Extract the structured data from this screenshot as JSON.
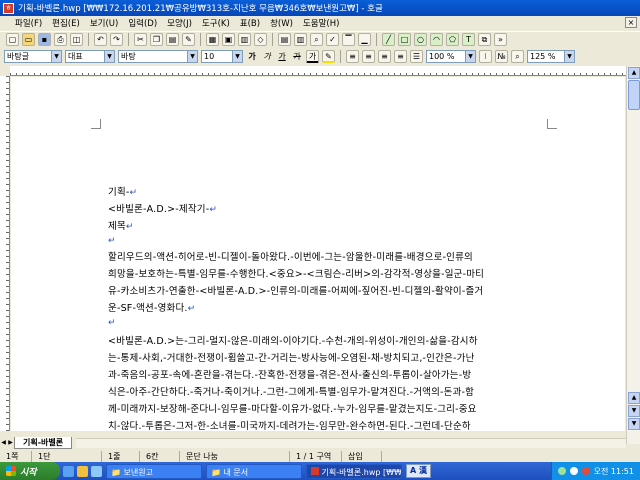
{
  "window": {
    "title": "기획-바벨론.hwp [₩₩172.16.201.21₩공유방₩313호-지난호 무음₩346호₩보낸원고₩] - 호글"
  },
  "menu": {
    "items": [
      "파일(F)",
      "편집(E)",
      "보기(U)",
      "입력(D)",
      "모양(J)",
      "도구(K)",
      "표(B)",
      "창(W)",
      "도움말(H)"
    ]
  },
  "toolbar2": {
    "style": "바탕글",
    "language": "대표",
    "font": "바탕",
    "size": "10",
    "bold": "가",
    "italic": "가",
    "underline": "가",
    "strike": "가",
    "zoom_a": "100 %",
    "zoom_b": "125 %"
  },
  "document": {
    "lines": [
      "기획-",
      "<바빌론-A.D.>-제작기-",
      "제목",
      "",
      "할리우드의-액션-히어로-빈-디젤이-돌아왔다.-이번에-그는-암울한-미래를-배경으로-인류의",
      "희망을-보호하는-특별-임무를-수행한다.<중요>-<크림슨-리버>의-감각적-영상을-일군-마티",
      "유-카소비츠가-연출한-<바빌론-A.D.>-인류의-미래를-어찌에-짚어진-빈-디젤의-활약이-즐거",
      "운-SF-액션-영화다.",
      "",
      "<바빌론-A.D.>는-그리-멀지-않은-미래의-이야기다.-수천-개의-위성이-개인의-삶을-감시하",
      "는-통제-사회,-거대한-전쟁이-휩쓸고-간-거리는-방사능에-오염된-채-방치되고,-인간은-가난",
      "과-죽음의-공포-속에-혼란을-겪는다.-잔혹한-전쟁을-겪은-전사-출신의-투롭이-살아가는-방",
      "식은-아주-간단하다.-죽거나-죽이거나.-그런-그에게-특별-임무가-맡겨진다.-거액의-돈과-함",
      "께-미래까지-보장해-준다니-임무를-마다할-이유가-없다.-누가-임무를-맡겼는지도-그리-중요",
      "치-않다.-투롭은-그저-한-소녀를-미국까지-데려가는-임무만-완수하면-된다.-그런데-단순하"
    ]
  },
  "tabs": {
    "doc_tab": "기획-바벨론"
  },
  "status": {
    "cells": [
      "1쪽",
      "1단",
      "1줄",
      "6칸",
      "문단 나눔",
      "1 / 1 구역",
      "삽입"
    ]
  },
  "taskbar": {
    "start": "시작",
    "tasks": [
      "보낸원고",
      "내 문서",
      "기획-바벨론.hwp [₩₩..."
    ],
    "lang": "A 漢",
    "clock": "오전 11:51"
  },
  "colors": {
    "titlebar": "#0a5fd8",
    "taskbar": "#3168d5",
    "start": "#3c9a3c",
    "paragraph_mark": "#2a54c8"
  }
}
